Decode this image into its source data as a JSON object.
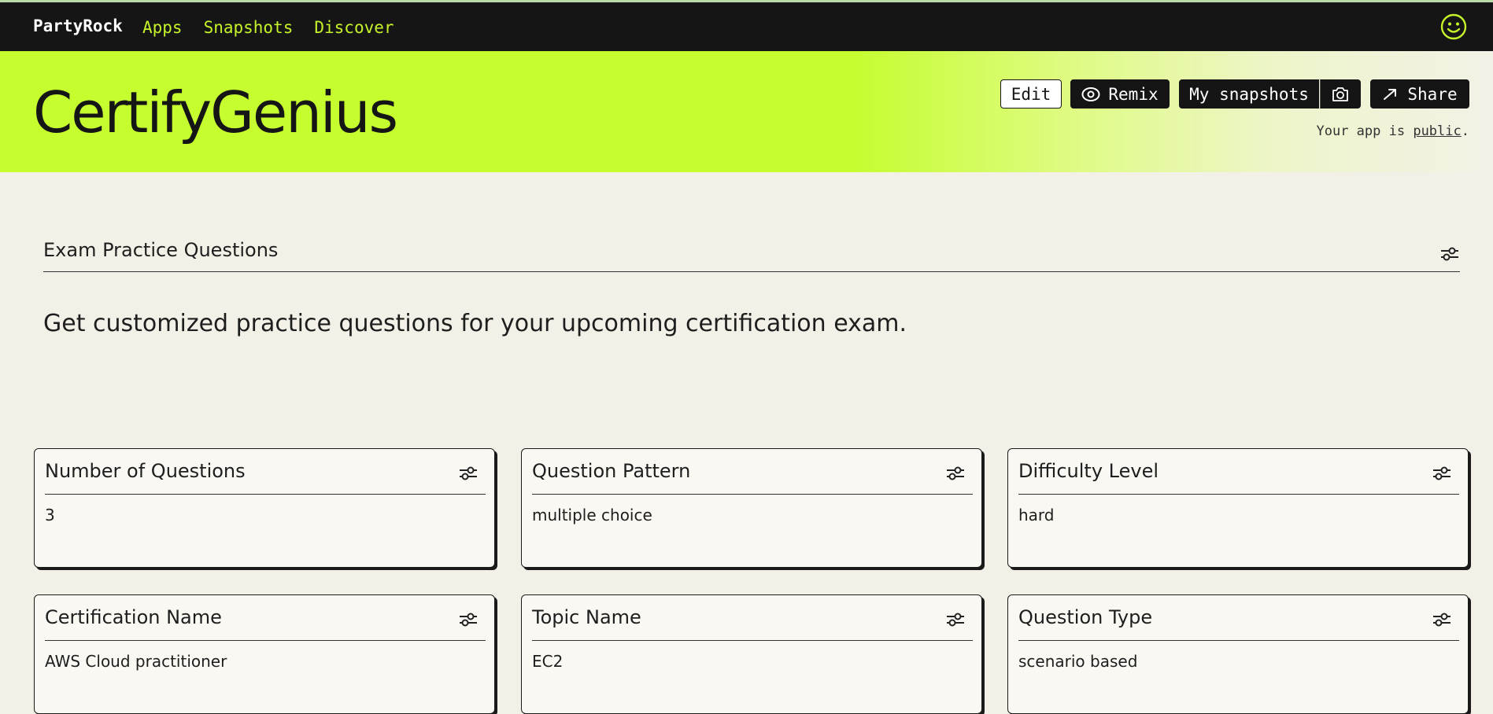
{
  "nav": {
    "brand": "PartyRock",
    "links": [
      "Apps",
      "Snapshots",
      "Discover"
    ]
  },
  "header": {
    "title": "CertifyGenius",
    "edit_label": "Edit",
    "remix_label": "Remix",
    "snapshots_label": "My snapshots",
    "share_label": "Share",
    "public_prefix": "Your app is ",
    "public_link": "public",
    "public_suffix": "."
  },
  "section": {
    "title": "Exam Practice Questions",
    "description": "Get customized practice questions for your upcoming certification exam."
  },
  "widgets": [
    {
      "title": "Number of Questions",
      "value": "3"
    },
    {
      "title": "Question Pattern",
      "value": "multiple choice"
    },
    {
      "title": "Difficulty Level",
      "value": "hard"
    },
    {
      "title": "Certification Name",
      "value": "AWS Cloud practitioner"
    },
    {
      "title": "Topic Name",
      "value": "EC2"
    },
    {
      "title": "Question Type",
      "value": "scenario based"
    }
  ],
  "icons": {
    "avatar": "smiley-face-icon",
    "remix": "eye-icon",
    "camera": "camera-icon",
    "share": "arrow-right-icon",
    "settings": "sliders-icon"
  },
  "colors": {
    "nav_bg": "#151515",
    "accent": "#c5fd2f",
    "nav_link": "#c5f22a",
    "page_bg": "#f3f1e7",
    "card_bg": "#f9f8f3"
  }
}
